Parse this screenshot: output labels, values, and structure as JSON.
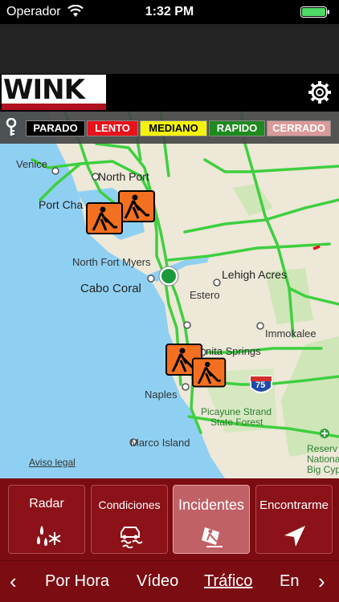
{
  "status": {
    "carrier": "Operador",
    "time": "1:32 PM"
  },
  "header": {
    "logo": "WINK"
  },
  "legend": [
    {
      "label": "PARADO",
      "bg": "#000000",
      "fg": "#ffffff"
    },
    {
      "label": "LENTO",
      "bg": "#e8121a",
      "fg": "#ffffff"
    },
    {
      "label": "MEDIANO",
      "bg": "#f4f20a",
      "fg": "#000000"
    },
    {
      "label": "RAPIDO",
      "bg": "#1f8a1f",
      "fg": "#ffffff"
    },
    {
      "label": "CERRADO",
      "bg": "#d99a9a",
      "fg": "#ffffff"
    }
  ],
  "map": {
    "labels": {
      "venice": "Venice",
      "north_port": "North Port",
      "port_charlotte": "Port Cha",
      "north_fort_myers": "North Fort Myers",
      "cabo_coral": "Cabo Coral",
      "lehigh_acres": "Lehigh Acres",
      "estero": "Estero",
      "immokalee": "Immokalee",
      "bonita_springs": "nita Springs",
      "naples": "Naples",
      "picayune": "Picayune Strand",
      "state_forest": "State Forest",
      "marco_island": "Marco Island",
      "reserv": "Reserv",
      "national": "National",
      "big_cypr": "Big Cypr",
      "interstate": "75"
    },
    "legal": "Aviso legal"
  },
  "tiles": [
    {
      "label": "Radar",
      "icon": "rain-snow-icon"
    },
    {
      "label": "Condiciones",
      "icon": "slippery-road-icon"
    },
    {
      "label": "Incidentes",
      "icon": "roadwork-icon"
    },
    {
      "label": "Encontrarme",
      "icon": "location-arrow-icon"
    }
  ],
  "nav": {
    "items": [
      "Por Hora",
      "Vídeo",
      "Tráfico",
      "En"
    ],
    "active": "Tráfico"
  },
  "colors": {
    "brand": "#7a0c12",
    "active_tile": "#c06166"
  }
}
